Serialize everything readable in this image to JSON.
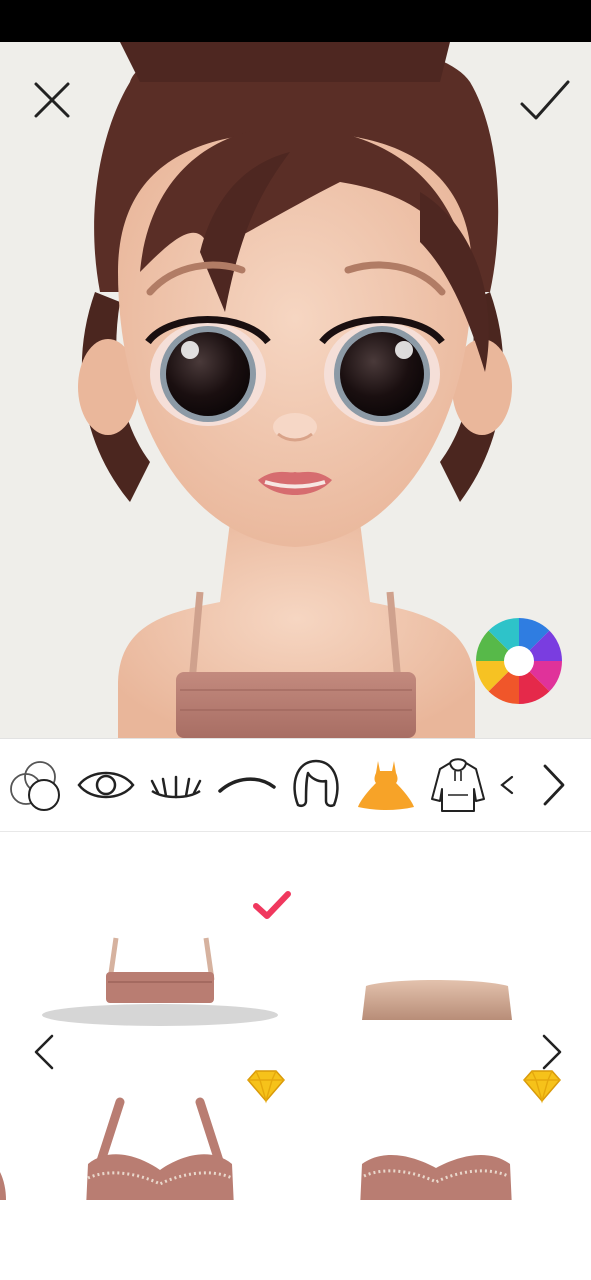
{
  "header": {
    "close_icon": "close-icon",
    "confirm_icon": "checkmark-icon"
  },
  "avatar_preview": {
    "description": "avatar-face-preview",
    "color_wheel_icon": "color-wheel-icon",
    "colors": {
      "hair": "#5a2e26",
      "skin": "#f1c7ae",
      "top": "#b77e73",
      "background": "#efeeea"
    }
  },
  "category_toolbar": {
    "items": [
      {
        "id": "skin",
        "icon": "circles-icon",
        "selected": false
      },
      {
        "id": "eyes",
        "icon": "eye-icon",
        "selected": false
      },
      {
        "id": "lashes",
        "icon": "eyelashes-icon",
        "selected": false
      },
      {
        "id": "brows",
        "icon": "eyebrow-icon",
        "selected": false
      },
      {
        "id": "hair",
        "icon": "hair-icon",
        "selected": false
      },
      {
        "id": "dress",
        "icon": "dress-icon",
        "selected": true
      },
      {
        "id": "hoodie",
        "icon": "hoodie-icon",
        "selected": false
      }
    ],
    "accent": "#f7a328",
    "next_icon": "chevron-right-icon",
    "partial_icon": "chevron-left-partial-icon"
  },
  "item_grid": {
    "items": [
      {
        "id": "strap-bandeau",
        "selected": true,
        "premium": false
      },
      {
        "id": "plain-bandeau",
        "selected": false,
        "premium": false
      },
      {
        "id": "sweetheart-strap-top",
        "selected": false,
        "premium": true
      },
      {
        "id": "sweetheart-bandeau",
        "selected": false,
        "premium": true
      }
    ],
    "selected_check_color": "#f0385e",
    "gem_color": "#f6c21a",
    "prev_icon": "chevron-left-icon",
    "next_icon": "chevron-right-icon"
  }
}
